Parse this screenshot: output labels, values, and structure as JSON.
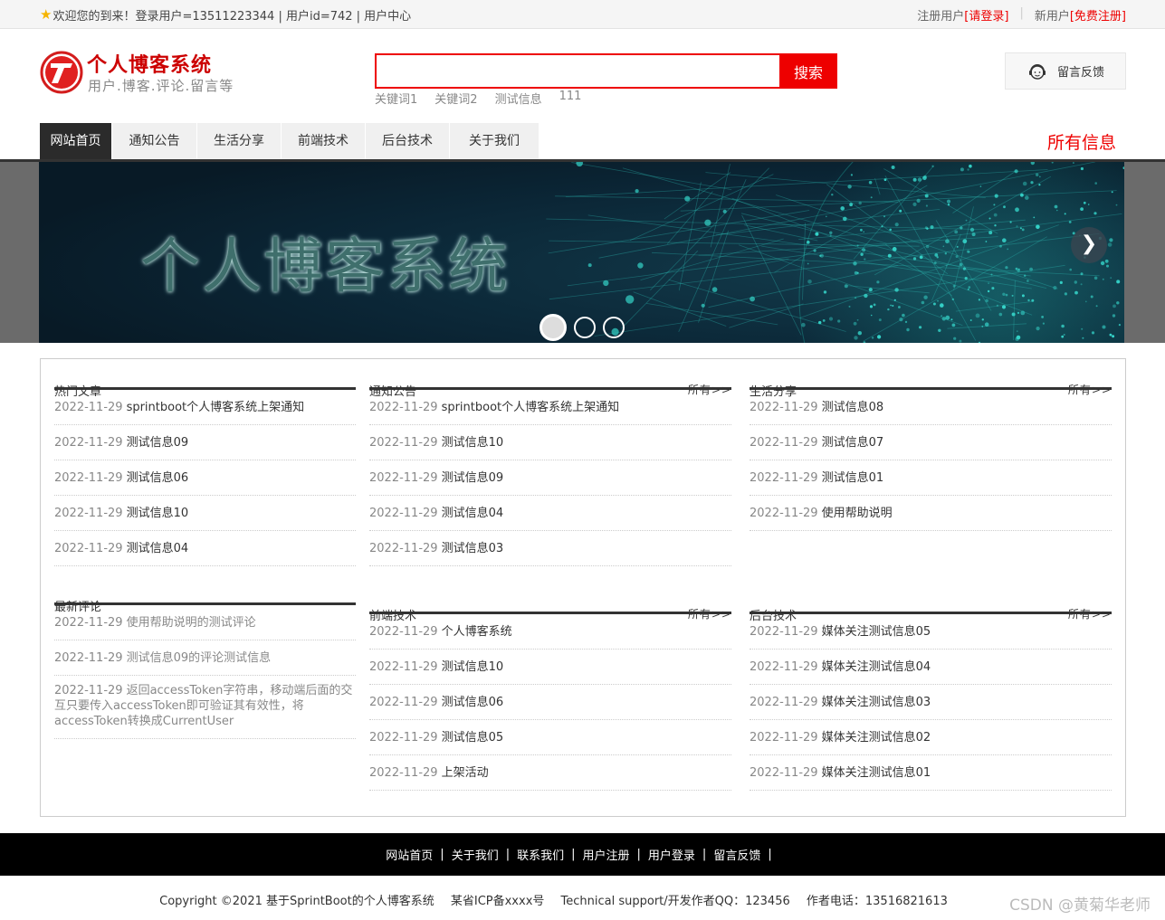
{
  "topbar": {
    "welcome": "欢迎您的到来！登录用户=13511223344 | 用户id=742 | 用户中心",
    "reg_user": "注册用户",
    "login_link": "[请登录]",
    "new_user": "新用户",
    "signup_link": "[免费注册]"
  },
  "header": {
    "title": "个人博客系统",
    "subtitle": "用户.博客.评论.留言等",
    "search_placeholder": "",
    "search_button": "搜索",
    "keywords": [
      "关键词1",
      "关键词2",
      "测试信息",
      "111"
    ],
    "feedback": "留言反馈"
  },
  "nav": {
    "items": [
      "网站首页",
      "通知公告",
      "生活分享",
      "前端技术",
      "后台技术",
      "关于我们"
    ],
    "all_info": "所有信息"
  },
  "banner": {
    "text": "个人博客系统",
    "next": "❯"
  },
  "more_label": "所有>>",
  "panels": {
    "hot": {
      "title": "热门文章",
      "items": [
        {
          "date": "2022-11-29",
          "text": "sprintboot个人博客系统上架通知"
        },
        {
          "date": "2022-11-29",
          "text": "测试信息09"
        },
        {
          "date": "2022-11-29",
          "text": "测试信息06"
        },
        {
          "date": "2022-11-29",
          "text": "测试信息10"
        },
        {
          "date": "2022-11-29",
          "text": "测试信息04"
        }
      ]
    },
    "comments": {
      "title": "最新评论",
      "items": [
        {
          "date": "2022-11-29",
          "text": "使用帮助说明的测试评论"
        },
        {
          "date": "2022-11-29",
          "text": "测试信息09的评论测试信息"
        },
        {
          "date": "2022-11-29",
          "text": "返回accessToken字符串，移动端后面的交互只要传入accessToken即可验证其有效性，将accessToken转换成CurrentUser"
        }
      ]
    },
    "notice": {
      "title": "通知公告",
      "items": [
        {
          "date": "2022-11-29",
          "text": "sprintboot个人博客系统上架通知"
        },
        {
          "date": "2022-11-29",
          "text": "测试信息10"
        },
        {
          "date": "2022-11-29",
          "text": "测试信息09"
        },
        {
          "date": "2022-11-29",
          "text": "测试信息04"
        },
        {
          "date": "2022-11-29",
          "text": "测试信息03"
        }
      ]
    },
    "life": {
      "title": "生活分享",
      "items": [
        {
          "date": "2022-11-29",
          "text": "测试信息08"
        },
        {
          "date": "2022-11-29",
          "text": "测试信息07"
        },
        {
          "date": "2022-11-29",
          "text": "测试信息01"
        },
        {
          "date": "2022-11-29",
          "text": "使用帮助说明"
        }
      ]
    },
    "frontend": {
      "title": "前端技术",
      "items": [
        {
          "date": "2022-11-29",
          "text": "个人博客系统"
        },
        {
          "date": "2022-11-29",
          "text": "测试信息10"
        },
        {
          "date": "2022-11-29",
          "text": "测试信息06"
        },
        {
          "date": "2022-11-29",
          "text": "测试信息05"
        },
        {
          "date": "2022-11-29",
          "text": "上架活动"
        }
      ]
    },
    "backend": {
      "title": "后台技术",
      "items": [
        {
          "date": "2022-11-29",
          "text": "媒体关注测试信息05"
        },
        {
          "date": "2022-11-29",
          "text": "媒体关注测试信息04"
        },
        {
          "date": "2022-11-29",
          "text": "媒体关注测试信息03"
        },
        {
          "date": "2022-11-29",
          "text": "媒体关注测试信息02"
        },
        {
          "date": "2022-11-29",
          "text": "媒体关注测试信息01"
        }
      ]
    }
  },
  "footer": {
    "links": [
      "网站首页",
      "关于我们",
      "联系我们",
      "用户注册",
      "用户登录",
      "留言反馈"
    ],
    "separator": "|",
    "copyright": "Copyright ©2021 基于SprintBoot的个人博客系统",
    "icp": "某省ICP备xxxx号",
    "support": "Technical support/开发作者QQ：123456",
    "phone": "作者电话：13516821613",
    "watermark": "CSDN @黄菊华老师"
  },
  "colors": {
    "accent": "#ee0000",
    "nav_active": "#2b2b2b",
    "footer_bg": "#000000",
    "banner_bg": "#0b2636"
  }
}
